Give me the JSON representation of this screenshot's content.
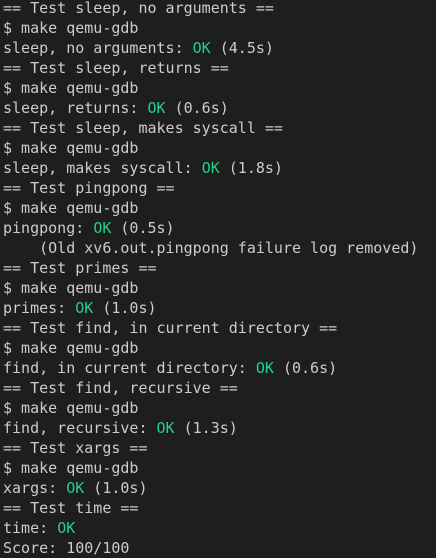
{
  "colors": {
    "background": "#1e1e1e",
    "text": "#cccccc",
    "ok": "#23d18b"
  },
  "lines": [
    {
      "text": "== Test sleep, no arguments =="
    },
    {
      "text": "$ make qemu-gdb"
    },
    {
      "text": "sleep, no arguments: ",
      "status": "OK",
      "tail": " (4.5s)"
    },
    {
      "text": "== Test sleep, returns =="
    },
    {
      "text": "$ make qemu-gdb"
    },
    {
      "text": "sleep, returns: ",
      "status": "OK",
      "tail": " (0.6s)"
    },
    {
      "text": "== Test sleep, makes syscall =="
    },
    {
      "text": "$ make qemu-gdb"
    },
    {
      "text": "sleep, makes syscall: ",
      "status": "OK",
      "tail": " (1.8s)"
    },
    {
      "text": "== Test pingpong =="
    },
    {
      "text": "$ make qemu-gdb"
    },
    {
      "text": "pingpong: ",
      "status": "OK",
      "tail": " (0.5s)"
    },
    {
      "text": "    (Old xv6.out.pingpong failure log removed)"
    },
    {
      "text": "== Test primes =="
    },
    {
      "text": "$ make qemu-gdb"
    },
    {
      "text": "primes: ",
      "status": "OK",
      "tail": " (1.0s)"
    },
    {
      "text": "== Test find, in current directory =="
    },
    {
      "text": "$ make qemu-gdb"
    },
    {
      "text": "find, in current directory: ",
      "status": "OK",
      "tail": " (0.6s)"
    },
    {
      "text": "== Test find, recursive =="
    },
    {
      "text": "$ make qemu-gdb"
    },
    {
      "text": "find, recursive: ",
      "status": "OK",
      "tail": " (1.3s)"
    },
    {
      "text": "== Test xargs =="
    },
    {
      "text": "$ make qemu-gdb"
    },
    {
      "text": "xargs: ",
      "status": "OK",
      "tail": " (1.0s)"
    },
    {
      "text": "== Test time =="
    },
    {
      "text": "time: ",
      "status": "OK",
      "tail": ""
    },
    {
      "text": "Score: 100/100"
    }
  ]
}
